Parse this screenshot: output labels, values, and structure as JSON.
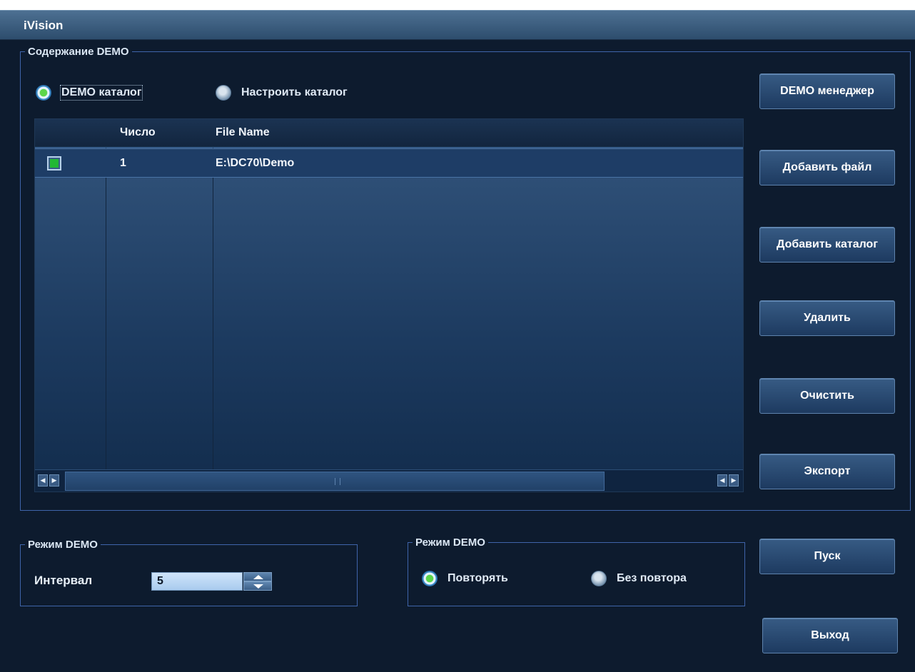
{
  "window": {
    "title": "iVision"
  },
  "content_group": {
    "legend": "Содержание DEMO",
    "radio_demo_catalog": {
      "label": "DEMO каталог",
      "checked": true
    },
    "radio_custom_catalog": {
      "label": "Настроить каталог",
      "checked": false
    }
  },
  "table": {
    "columns": [
      "",
      "Число",
      "File Name"
    ],
    "rows": [
      {
        "checked": true,
        "number": "1",
        "file_name": "E:\\DC70\\Demo"
      }
    ]
  },
  "side_buttons": {
    "demo_manager": "DEMO менеджер",
    "add_file": "Добавить файл",
    "add_catalog": "Добавить каталог",
    "delete": "Удалить",
    "clear": "Очистить",
    "export": "Экспорт"
  },
  "interval_group": {
    "legend": "Режим DEMO",
    "interval_label": "Интервал",
    "interval_value": "5"
  },
  "repeat_group": {
    "legend": "Режим DEMO",
    "repeat": {
      "label": "Повторять",
      "checked": true
    },
    "no_repeat": {
      "label": "Без повтора",
      "checked": false
    }
  },
  "bottom_buttons": {
    "start": "Пуск",
    "exit": "Выход"
  },
  "colors": {
    "background": "#0d1b2e",
    "accent_border": "#3f64aa",
    "button": "#2a4a72",
    "check_green": "#22b833"
  }
}
